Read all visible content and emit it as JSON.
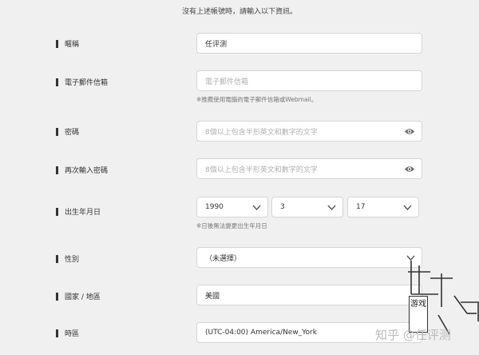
{
  "intro": "沒有上述帳號時，請輸入以下資訊。",
  "form": {
    "nickname": {
      "label": "暱稱",
      "value": "任评测"
    },
    "email": {
      "label": "電子郵件信箱",
      "placeholder": "電子郵件信箱",
      "hint": "※推薦使用電腦的電子郵件信箱或Webmail。"
    },
    "password": {
      "label": "密碼",
      "placeholder": "8個以上包含半形英文和數字的文字"
    },
    "password_confirm": {
      "label": "再次輸入密碼",
      "placeholder": "8個以上包含半形英文和數字的文字"
    },
    "birthday": {
      "label": "出生年月日",
      "year": "1990",
      "month": "3",
      "day": "17",
      "hint": "※日後無法變更出生年月日"
    },
    "gender": {
      "label": "性別",
      "value": "（未選擇）"
    },
    "country": {
      "label": "國家 / 地區",
      "value": "美國"
    },
    "timezone": {
      "label": "時區",
      "value": "(UTC-04:00) America/New_York"
    }
  },
  "watermark": {
    "text": "知乎 @任评测",
    "game_label": "游戏"
  },
  "colors": {
    "background": "#f0f0f0",
    "field_border": "#d6d6d6",
    "placeholder": "#b0b0b0"
  }
}
